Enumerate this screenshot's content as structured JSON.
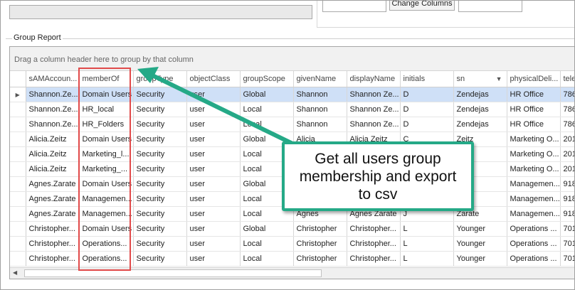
{
  "toolbar": {
    "change_columns_label": "Change Columns"
  },
  "group_report": {
    "title": "Group Report",
    "group_panel_text": "Drag a column header here to group by that column",
    "columns": [
      "sAMAccoun...",
      "memberOf",
      "groupType",
      "objectClass",
      "groupScope",
      "givenName",
      "displayName",
      "initials",
      "sn",
      "physicalDeli...",
      "tele"
    ],
    "sorted_column": "sn",
    "rows": [
      [
        "Shannon.Ze...",
        "Domain Users",
        "Security",
        "user",
        "Global",
        "Shannon",
        "Shannon Ze...",
        "D",
        "Zendejas",
        "HR Office",
        "786"
      ],
      [
        "Shannon.Ze...",
        "HR_local",
        "Security",
        "user",
        "Local",
        "Shannon",
        "Shannon Ze...",
        "D",
        "Zendejas",
        "HR Office",
        "786"
      ],
      [
        "Shannon.Ze...",
        "HR_Folders",
        "Security",
        "user",
        "Local",
        "Shannon",
        "Shannon Ze...",
        "D",
        "Zendejas",
        "HR Office",
        "786"
      ],
      [
        "Alicia.Zeitz",
        "Domain Users",
        "Security",
        "user",
        "Global",
        "Alicia",
        "Alicia Zeitz",
        "C",
        "Zeitz",
        "Marketing O...",
        "201"
      ],
      [
        "Alicia.Zeitz",
        "Marketing_l...",
        "Security",
        "user",
        "Local",
        "",
        "",
        "",
        "",
        "Marketing O...",
        "201"
      ],
      [
        "Alicia.Zeitz",
        "Marketing_...",
        "Security",
        "user",
        "Local",
        "",
        "",
        "",
        "",
        "Marketing O...",
        "201"
      ],
      [
        "Agnes.Zarate",
        "Domain Users",
        "Security",
        "user",
        "Global",
        "",
        "",
        "",
        "e",
        "Managemen...",
        "918"
      ],
      [
        "Agnes.Zarate",
        "Managemen...",
        "Security",
        "user",
        "Local",
        "",
        "",
        "",
        "e",
        "Managemen...",
        "918"
      ],
      [
        "Agnes.Zarate",
        "Managemen...",
        "Security",
        "user",
        "Local",
        "Agnes",
        "Agnes Zarate",
        "J",
        "Zarate",
        "Managemen...",
        "918"
      ],
      [
        "Christopher...",
        "Domain Users",
        "Security",
        "user",
        "Global",
        "Christopher",
        "Christopher...",
        "L",
        "Younger",
        "Operations ...",
        "701"
      ],
      [
        "Christopher...",
        "Operations...",
        "Security",
        "user",
        "Local",
        "Christopher",
        "Christopher...",
        "L",
        "Younger",
        "Operations ...",
        "701"
      ],
      [
        "Christopher...",
        "Operations...",
        "Security",
        "user",
        "Local",
        "Christopher",
        "Christopher...",
        "L",
        "Younger",
        "Operations ...",
        "701"
      ]
    ]
  },
  "annotation": {
    "callout_text": "Get all users group membership and export to csv",
    "arrow_color": "#25a987",
    "highlight_color": "#e14a4a"
  },
  "colors": {
    "selected_row": "#cfe0f7",
    "border": "#a6a6a6"
  }
}
